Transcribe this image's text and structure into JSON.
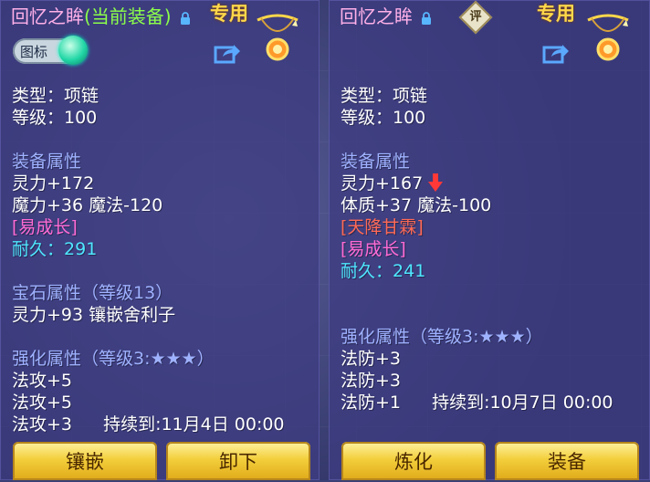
{
  "left": {
    "title": "回忆之眸",
    "equipped_tag": "(当前装备)",
    "special": "专用",
    "icon_toggle_label": "图标",
    "type_line": "类型：项链",
    "level_line": "等级：100",
    "equip_attr_header": "装备属性",
    "attr1": "灵力+172",
    "attr2": "魔力+36 魔法-120",
    "growth_tag": "[易成长]",
    "durability_label": "耐久：",
    "durability_value": "291",
    "gem_header": "宝石属性（等级13）",
    "gem_line": "灵力+93 镶嵌舍利子",
    "enhance_header": "强化属性（等级3:★★★）",
    "enhance1": "法攻+5",
    "enhance2": "法攻+5",
    "enhance3": "法攻+3",
    "until": "持续到:11月4日 00:00",
    "btn_inlay": "镶嵌",
    "btn_unequip": "卸下"
  },
  "right": {
    "title": "回忆之眸",
    "rate_badge": "评",
    "special": "专用",
    "type_line": "类型：项链",
    "level_line": "等级：100",
    "equip_attr_header": "装备属性",
    "attr1": "灵力+167",
    "attr2": "体质+37 魔法-100",
    "blessing_tag": "[天降甘霖]",
    "growth_tag": "[易成长]",
    "durability_label": "耐久：",
    "durability_value": "241",
    "enhance_header": "强化属性（等级3:★★★）",
    "enhance1": "法防+3",
    "enhance2": "法防+3",
    "enhance3": "法防+1",
    "until": "持续到:10月7日 00:00",
    "btn_refine": "炼化",
    "btn_equip": "装备"
  }
}
